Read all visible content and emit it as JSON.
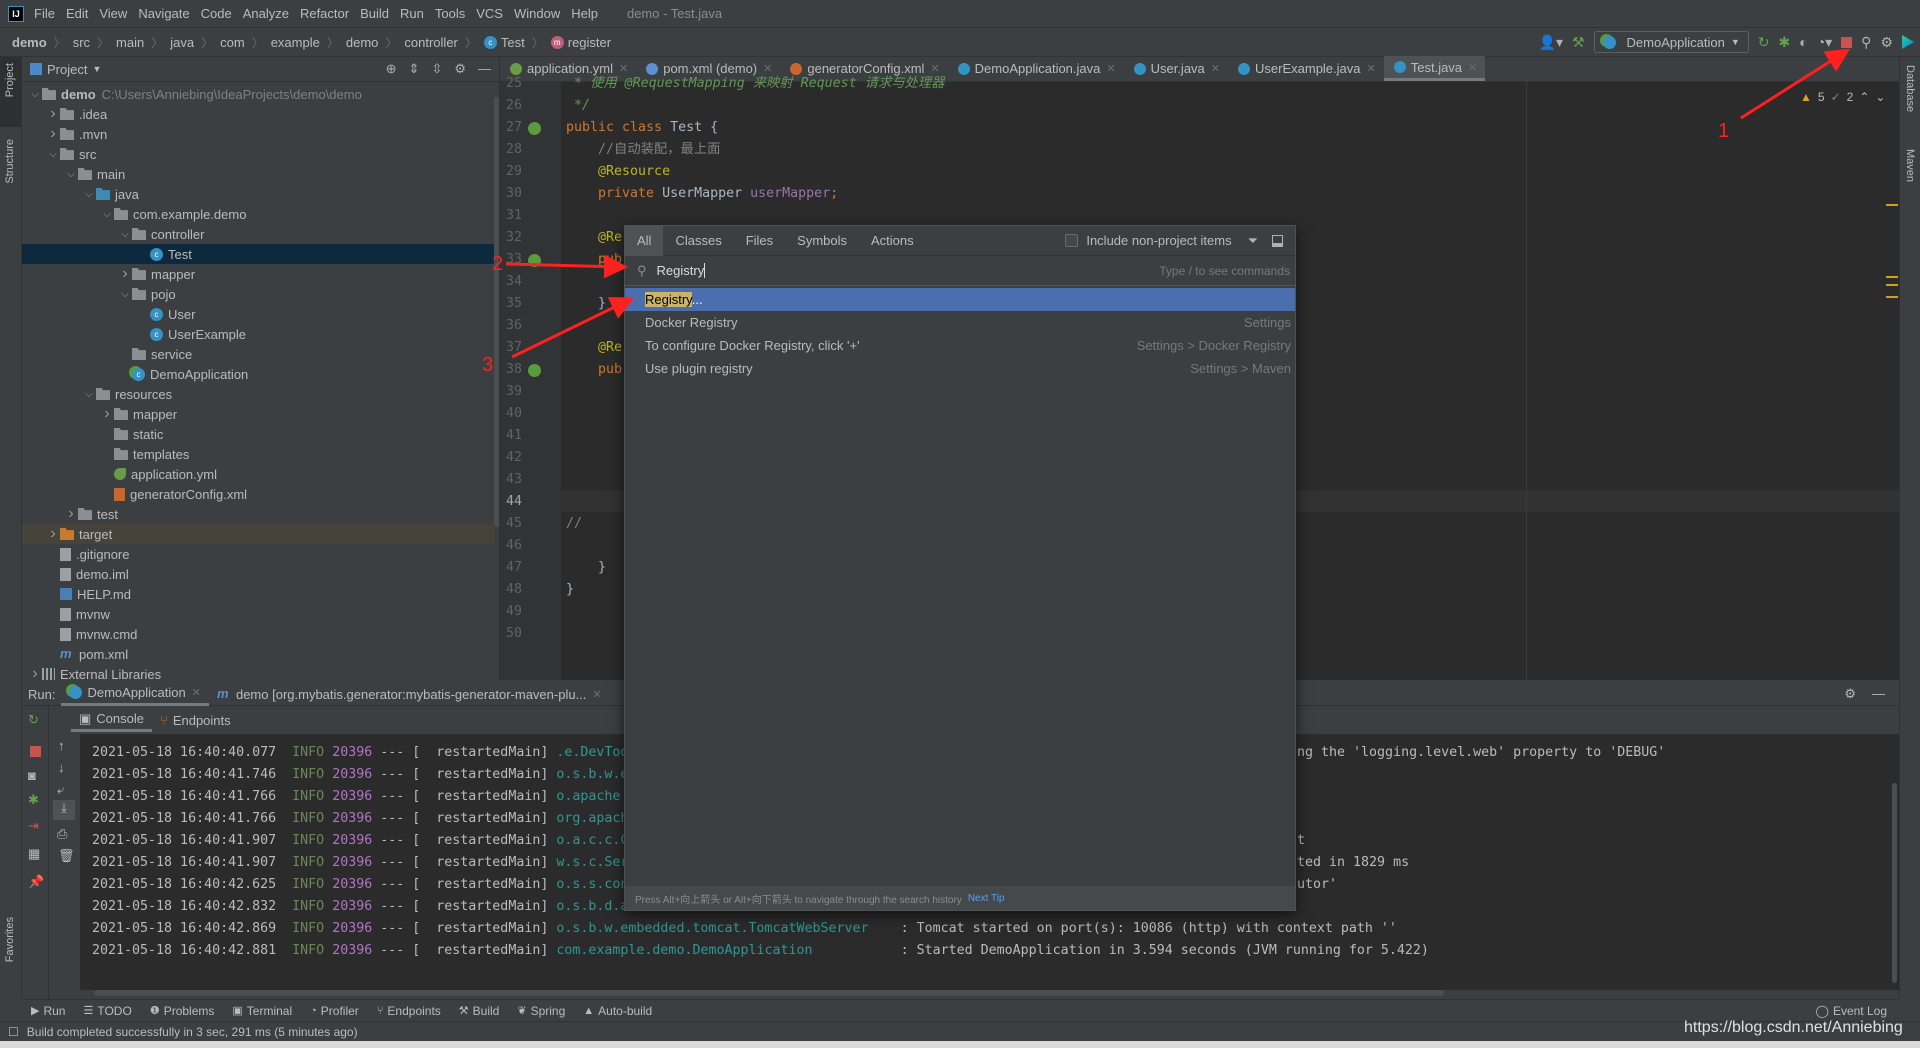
{
  "menubar": {
    "items": [
      "File",
      "Edit",
      "View",
      "Navigate",
      "Code",
      "Analyze",
      "Refactor",
      "Build",
      "Run",
      "Tools",
      "VCS",
      "Window",
      "Help"
    ],
    "title": "demo - Test.java"
  },
  "breadcrumb": [
    "demo",
    "src",
    "main",
    "java",
    "com",
    "example",
    "demo",
    "controller",
    "Test",
    "register"
  ],
  "toolbar": {
    "run_config": "DemoApplication",
    "icons": [
      "user-icon",
      "hammer-icon",
      "rerun-icon",
      "debug-icon",
      "coverage-icon",
      "profiler-icon",
      "stop-icon",
      "search-icon",
      "gear-icon",
      "jetbrains-logo-icon"
    ]
  },
  "left_strip": {
    "project": "Project",
    "structure": "Structure",
    "favorites": "Favorites"
  },
  "right_strip": {
    "database": "Database",
    "maven": "Maven"
  },
  "project": {
    "title": "Project",
    "tree": [
      {
        "name": "demo",
        "path": "C:\\Users\\Anniebing\\IdeaProjects\\demo\\demo",
        "level": 0,
        "state": "open",
        "icon": "folder",
        "bold": true
      },
      {
        "name": ".idea",
        "level": 1,
        "state": "closed",
        "icon": "folder"
      },
      {
        "name": ".mvn",
        "level": 1,
        "state": "closed",
        "icon": "folder"
      },
      {
        "name": "src",
        "level": 1,
        "state": "open",
        "icon": "folder"
      },
      {
        "name": "main",
        "level": 2,
        "state": "open",
        "icon": "folder"
      },
      {
        "name": "java",
        "level": 3,
        "state": "open",
        "icon": "blue"
      },
      {
        "name": "com.example.demo",
        "level": 4,
        "state": "open",
        "icon": "package"
      },
      {
        "name": "controller",
        "level": 5,
        "state": "open",
        "icon": "package"
      },
      {
        "name": "Test",
        "level": 6,
        "state": "none",
        "icon": "class",
        "selected": true
      },
      {
        "name": "mapper",
        "level": 5,
        "state": "closed",
        "icon": "package"
      },
      {
        "name": "pojo",
        "level": 5,
        "state": "open",
        "icon": "package"
      },
      {
        "name": "User",
        "level": 6,
        "state": "none",
        "icon": "class"
      },
      {
        "name": "UserExample",
        "level": 6,
        "state": "none",
        "icon": "class"
      },
      {
        "name": "service",
        "level": 5,
        "state": "none",
        "icon": "package"
      },
      {
        "name": "DemoApplication",
        "level": 5,
        "state": "none",
        "icon": "spring"
      },
      {
        "name": "resources",
        "level": 3,
        "state": "open",
        "icon": "folder"
      },
      {
        "name": "mapper",
        "level": 4,
        "state": "closed",
        "icon": "folder"
      },
      {
        "name": "static",
        "level": 4,
        "state": "none",
        "icon": "folder"
      },
      {
        "name": "templates",
        "level": 4,
        "state": "none",
        "icon": "folder"
      },
      {
        "name": "application.yml",
        "level": 4,
        "state": "none",
        "icon": "yml"
      },
      {
        "name": "generatorConfig.xml",
        "level": 4,
        "state": "none",
        "icon": "xml"
      },
      {
        "name": "test",
        "level": 2,
        "state": "closed",
        "icon": "folder"
      },
      {
        "name": "target",
        "level": 1,
        "state": "closed",
        "icon": "orange",
        "excluded": true
      },
      {
        "name": ".gitignore",
        "level": 1,
        "state": "none",
        "icon": "file"
      },
      {
        "name": "demo.iml",
        "level": 1,
        "state": "none",
        "icon": "file"
      },
      {
        "name": "HELP.md",
        "level": 1,
        "state": "none",
        "icon": "md"
      },
      {
        "name": "mvnw",
        "level": 1,
        "state": "none",
        "icon": "file"
      },
      {
        "name": "mvnw.cmd",
        "level": 1,
        "state": "none",
        "icon": "file"
      },
      {
        "name": "pom.xml",
        "level": 1,
        "state": "none",
        "icon": "maven"
      },
      {
        "name": "External Libraries",
        "level": 0,
        "state": "closed",
        "icon": "lib"
      }
    ]
  },
  "editor": {
    "tabs": [
      {
        "label": "application.yml",
        "icon": "#6a9b4a"
      },
      {
        "label": "pom.xml (demo)",
        "icon": "#5b8fd4"
      },
      {
        "label": "generatorConfig.xml",
        "icon": "#c8662f"
      },
      {
        "label": "DemoApplication.java",
        "icon": "#3592c4"
      },
      {
        "label": "User.java",
        "icon": "#3592c4"
      },
      {
        "label": "UserExample.java",
        "icon": "#3592c4"
      },
      {
        "label": "Test.java",
        "icon": "#3592c4",
        "active": true
      }
    ],
    "inspections": {
      "warnings": "5",
      "weak_warnings": "2"
    },
    "current_line": 44,
    "lines": [
      {
        "n": 25,
        "parts": [
          [
            "doc",
            " * 使用 @RequestMapping 来映射 Request 请求与处理器"
          ]
        ]
      },
      {
        "n": 26,
        "parts": [
          [
            "doc",
            " */"
          ]
        ]
      },
      {
        "n": 27,
        "parts": [
          [
            "kw",
            "public class "
          ],
          [
            "txt",
            "Test {"
          ]
        ],
        "gutter": "spring"
      },
      {
        "n": 28,
        "parts": [
          [
            "cm",
            "    //自动装配，最上面"
          ]
        ]
      },
      {
        "n": 29,
        "parts": [
          [
            "ann",
            "    @Resource"
          ]
        ]
      },
      {
        "n": 30,
        "parts": [
          [
            "kw",
            "    private "
          ],
          [
            "txt",
            "UserMapper "
          ],
          [
            "fld",
            "userMapper"
          ],
          [
            "kw",
            ";"
          ]
        ]
      },
      {
        "n": 31,
        "parts": []
      },
      {
        "n": 32,
        "parts": [
          [
            "ann",
            "    @Re"
          ]
        ]
      },
      {
        "n": 33,
        "parts": [
          [
            "kw",
            "    pub"
          ]
        ],
        "gutter": "spring"
      },
      {
        "n": 34,
        "parts": []
      },
      {
        "n": 35,
        "parts": [
          [
            "txt",
            "    }"
          ]
        ]
      },
      {
        "n": 36,
        "parts": []
      },
      {
        "n": 37,
        "parts": [
          [
            "ann",
            "    @Re"
          ]
        ]
      },
      {
        "n": 38,
        "parts": [
          [
            "kw",
            "    pub"
          ]
        ],
        "gutter": "spring"
      },
      {
        "n": 39,
        "parts": []
      },
      {
        "n": 40,
        "parts": []
      },
      {
        "n": 41,
        "parts": []
      },
      {
        "n": 42,
        "parts": []
      },
      {
        "n": 43,
        "parts": []
      },
      {
        "n": 44,
        "parts": []
      },
      {
        "n": 45,
        "parts": [
          [
            "cm",
            "//"
          ]
        ]
      },
      {
        "n": 46,
        "parts": []
      },
      {
        "n": 47,
        "parts": [
          [
            "txt",
            "    }"
          ]
        ]
      },
      {
        "n": 48,
        "parts": [
          [
            "txt",
            "}"
          ]
        ]
      },
      {
        "n": 49,
        "parts": []
      },
      {
        "n": 50,
        "parts": []
      }
    ]
  },
  "search_popup": {
    "tabs": [
      "All",
      "Classes",
      "Files",
      "Symbols",
      "Actions"
    ],
    "active_tab": "All",
    "include_non_project": {
      "label": "Include non-project items",
      "checked": false
    },
    "query": "Registry",
    "hint": "Type / to see commands",
    "results": [
      {
        "label": "Registry",
        "suffix": "...",
        "location": "",
        "selected": true
      },
      {
        "label": "Docker Registry",
        "location": "Settings"
      },
      {
        "label": "To configure Docker Registry, click '+'",
        "location": "Settings > Docker Registry"
      },
      {
        "label": "Use plugin registry",
        "location": "Settings > Maven"
      }
    ],
    "footer": "Press Alt+向上箭头 or Alt+向下箭头 to navigate through the search history",
    "next_tip": "Next Tip"
  },
  "run": {
    "label": "Run:",
    "tabs": [
      {
        "label": "DemoApplication",
        "active": true
      },
      {
        "label": "demo [org.mybatis.generator:mybatis-generator-maven-plu..."
      }
    ],
    "subtabs": [
      "Console",
      "Endpoints"
    ],
    "console": [
      {
        "ts": "2021-05-18 16:40:40.077",
        "level": "INFO",
        "pid": "20396",
        "thread": "restartedMain",
        "logger": ".e.DevToo",
        "msg": "",
        "tail": "ng the 'logging.level.web' property to 'DEBUG'"
      },
      {
        "ts": "2021-05-18 16:40:41.746",
        "level": "INFO",
        "pid": "20396",
        "thread": "restartedMain",
        "logger": "o.s.b.w.e",
        "msg": "",
        "tail": ""
      },
      {
        "ts": "2021-05-18 16:40:41.766",
        "level": "INFO",
        "pid": "20396",
        "thread": "restartedMain",
        "logger": "o.apache",
        "msg": "",
        "tail": ""
      },
      {
        "ts": "2021-05-18 16:40:41.766",
        "level": "INFO",
        "pid": "20396",
        "thread": "restartedMain",
        "logger": "org.apach",
        "msg": "",
        "tail": ""
      },
      {
        "ts": "2021-05-18 16:40:41.907",
        "level": "INFO",
        "pid": "20396",
        "thread": "restartedMain",
        "logger": "o.a.c.c.C",
        "msg": "",
        "tail": "t"
      },
      {
        "ts": "2021-05-18 16:40:41.907",
        "level": "INFO",
        "pid": "20396",
        "thread": "restartedMain",
        "logger": "w.s.c.Ser",
        "msg": "",
        "tail": "ted in 1829 ms"
      },
      {
        "ts": "2021-05-18 16:40:42.625",
        "level": "INFO",
        "pid": "20396",
        "thread": "restartedMain",
        "logger": "o.s.s.con",
        "msg": "",
        "tail": "utor'"
      },
      {
        "ts": "2021-05-18 16:40:42.832",
        "level": "INFO",
        "pid": "20396",
        "thread": "restartedMain",
        "logger": "o.s.b.d.a",
        "msg": "",
        "tail": ""
      },
      {
        "ts": "2021-05-18 16:40:42.869",
        "level": "INFO",
        "pid": "20396",
        "thread": "restartedMain",
        "logger": "o.s.b.w.embedded.tomcat.TomcatWebServer",
        "msg": ": Tomcat started on port(s): 10086 (http) with context path ''",
        "tail": ""
      },
      {
        "ts": "2021-05-18 16:40:42.881",
        "level": "INFO",
        "pid": "20396",
        "thread": "restartedMain",
        "logger": "com.example.demo.DemoApplication",
        "msg": ": Started DemoApplication in 3.594 seconds (JVM running for 5.422)",
        "tail": ""
      }
    ]
  },
  "bottom_bar": {
    "items": [
      "Run",
      "TODO",
      "Problems",
      "Terminal",
      "Profiler",
      "Endpoints",
      "Build",
      "Spring",
      "Auto-build"
    ],
    "event_log": "Event Log"
  },
  "status": "Build completed successfully in 3 sec, 291 ms (5 minutes ago)",
  "watermark": "https://blog.csdn.net/Anniebing",
  "annotations": [
    "1",
    "2",
    "3"
  ],
  "colors": {
    "accent": "#4b6eaf",
    "selection": "#0d293e",
    "annotation": "#ff2020",
    "editor_bg": "#2b2b2b",
    "panel_bg": "#3c3f41"
  }
}
